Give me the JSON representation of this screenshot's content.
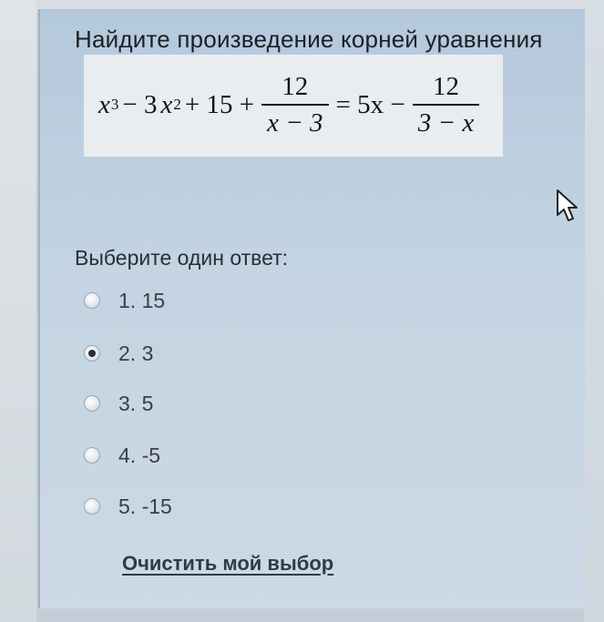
{
  "question": {
    "text": "Найдите произведение корней уравнения",
    "formula": {
      "x": "x",
      "exp3": "3",
      "minus_3x": "− 3",
      "exp2": "2",
      "plus15": "+ 15 +",
      "frac1_num": "12",
      "frac1_den": "x − 3",
      "equals_5x": "= 5x −",
      "frac2_num": "12",
      "frac2_den": "3 − x"
    }
  },
  "answer_prompt": "Выберите один ответ:",
  "options": [
    {
      "label": "1. 15",
      "selected": false
    },
    {
      "label": "2. 3",
      "selected": true
    },
    {
      "label": "3. 5",
      "selected": false
    },
    {
      "label": "4. -5",
      "selected": false
    },
    {
      "label": "5. -15",
      "selected": false
    }
  ],
  "clear_choice_label": "Очистить мой выбор",
  "icons": {
    "cursor": "mouse-pointer-icon"
  }
}
